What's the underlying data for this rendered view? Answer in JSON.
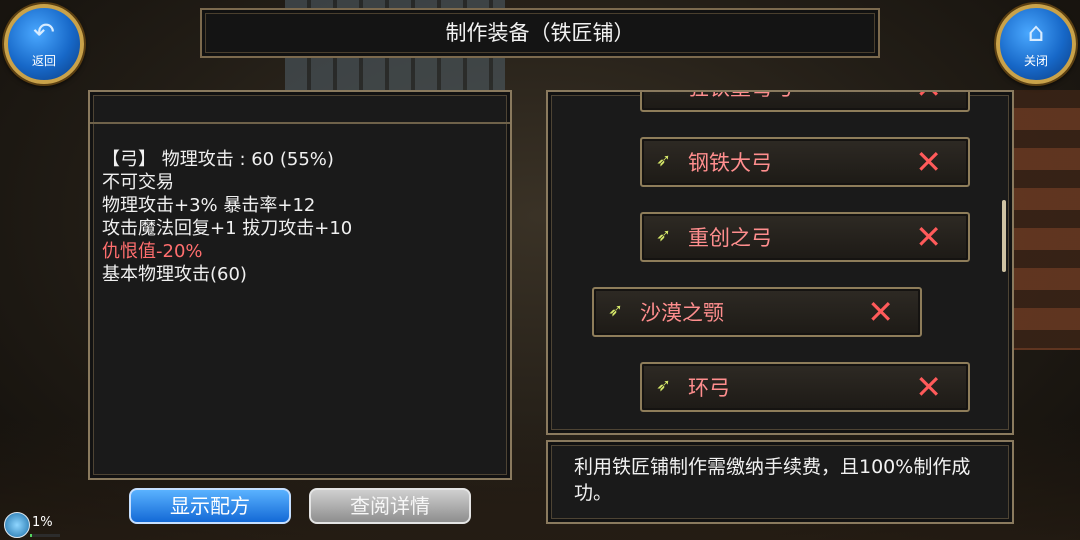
{
  "window_title": "制作装备（铁匠铺）",
  "nav": {
    "back_label": "返回",
    "back_icon": "back-arrow-icon",
    "close_label": "关闭",
    "close_icon": "home-icon"
  },
  "description": {
    "line1": "【弓】 物理攻击 :  60 (55%)",
    "line2": "不可交易",
    "line3": "物理攻击+3% 暴击率+12",
    "line4": "攻击魔法回复+1 拔刀攻击+10",
    "line5": "仇恨值-20%",
    "line6": "基本物理攻击(60)"
  },
  "recipes": [
    {
      "name": "狂铁重弩弓",
      "icon": "bow-icon"
    },
    {
      "name": "钢铁大弓",
      "icon": "bow-icon"
    },
    {
      "name": "重创之弓",
      "icon": "bow-icon"
    },
    {
      "name": "沙漠之颚",
      "icon": "bow-icon",
      "selected": true
    },
    {
      "name": "环弓",
      "icon": "bow-icon"
    }
  ],
  "x_glyph": "✕",
  "info_text": "利用铁匠铺制作需缴纳手续费，且100%制作成功。",
  "buttons": {
    "show_recipe": "显示配方",
    "view_details": "查阅详情"
  },
  "status": {
    "percent_label": "1%",
    "progress": 0.01
  },
  "colors": {
    "recipe_name": "#ff8e8e",
    "remove_x": "#ff5a5a",
    "penalty_text": "#ff6e6e",
    "primary_button": "#1369d6"
  }
}
